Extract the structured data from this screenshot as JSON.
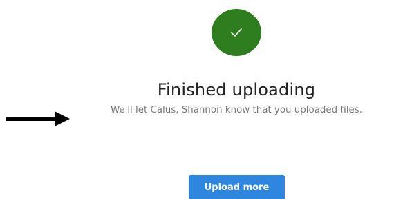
{
  "status": {
    "icon": "checkmark-icon",
    "color": "#2e7d1e",
    "title": "Finished uploading",
    "message": "We'll let Calus, Shannon know that you uploaded files."
  },
  "annotation": {
    "icon": "arrow-right-icon",
    "color": "#000000"
  },
  "actions": {
    "upload_more_label": "Upload more",
    "button_color": "#2e86de"
  }
}
